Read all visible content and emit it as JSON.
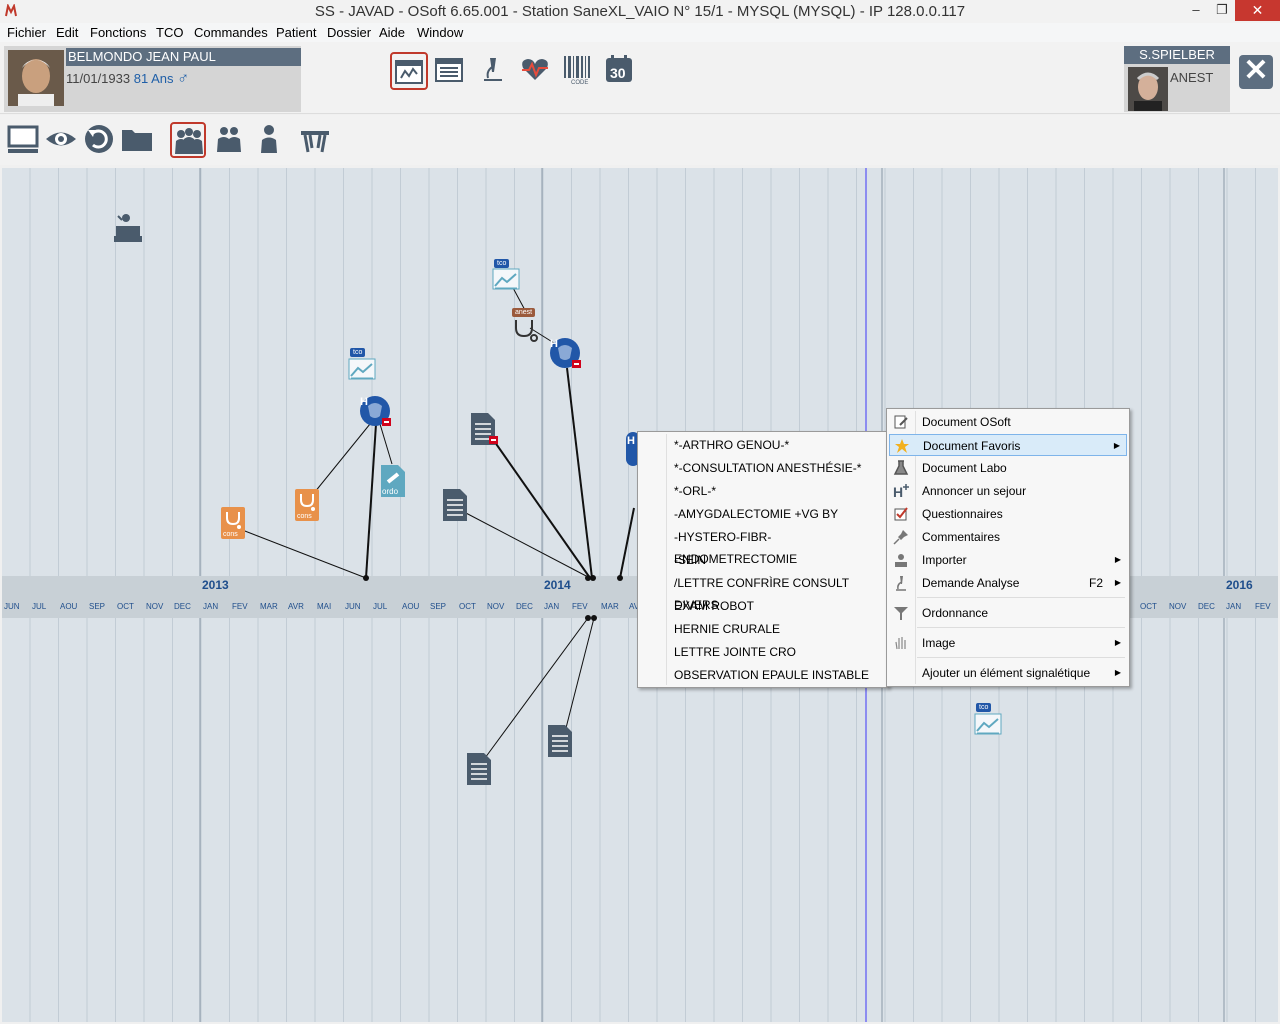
{
  "window": {
    "title": "SS - JAVAD - OSoft 6.65.001 - Station SaneXL_VAIO N° 15/1 - MYSQL (MYSQL) - IP 128.0.0.117",
    "minimize": "–",
    "maximize": "❐",
    "close": "✕"
  },
  "menubar": [
    "Fichier",
    "Edit",
    "Fonctions",
    "TCO",
    "Commandes",
    "Patient",
    "Dossier",
    "Aide",
    "Window"
  ],
  "patient": {
    "name": "BELMONDO  JEAN PAUL",
    "dob": "11/01/1933",
    "age": "81 Ans",
    "gender_symbol": "♂"
  },
  "user": {
    "name": "S.SPIELBER",
    "role": "ANEST"
  },
  "header_tools": [
    "timeline-icon",
    "document-list-icon",
    "microscope-icon",
    "heart-icon",
    "barcode-icon",
    "calendar-30-icon"
  ],
  "calendar_day": "30",
  "barcode_text": "CODE",
  "toolbar2": [
    "computer-icon",
    "eye-icon",
    "refresh-icon",
    "folder-icon",
    "group-icon",
    "couple-icon",
    "person-icon",
    "table-icon"
  ],
  "timeline": {
    "years": [
      "2013",
      "2014",
      "2016"
    ],
    "months_left": [
      "JUN",
      "JUL",
      "AOU",
      "SEP",
      "OCT",
      "NOV",
      "DEC",
      "JAN",
      "FEV",
      "MAR",
      "AVR",
      "MAI",
      "JUN",
      "JUL",
      "AOU",
      "SEP",
      "OCT",
      "NOV",
      "DEC",
      "JAN",
      "FEV",
      "MAR",
      "AV"
    ],
    "months_right": [
      "OCT",
      "NOV",
      "DEC",
      "JAN",
      "FEV"
    ],
    "tags": {
      "tco": "tco",
      "anest": "anest",
      "cons": "cons",
      "ordo": "ordo",
      "hospital": "H"
    }
  },
  "context_menu": {
    "items": [
      {
        "label": "Document OSoft",
        "icon": "document-edit-icon"
      },
      {
        "label": "Document Favoris",
        "icon": "star-icon",
        "submenu": true,
        "highlighted": true
      },
      {
        "label": "Document Labo",
        "icon": "flask-icon"
      },
      {
        "label": "Annoncer un sejour",
        "icon": "hospital-plus-icon"
      },
      {
        "label": "Questionnaires",
        "icon": "checkbox-icon"
      },
      {
        "label": "Commentaires",
        "icon": "pin-icon"
      },
      {
        "label": "Importer",
        "icon": "import-icon",
        "submenu": true
      },
      {
        "label": "Demande Analyse",
        "icon": "microscope-icon",
        "shortcut": "F2",
        "submenu": true
      },
      {
        "label": "Ordonnance",
        "icon": "funnel-icon"
      },
      {
        "label": "Image",
        "icon": "hand-icon",
        "submenu": true
      },
      {
        "label": "Ajouter un élément signalétique",
        "icon": "",
        "submenu": true
      }
    ]
  },
  "favorites_submenu": [
    "*-ARTHRO GENOU-*",
    "*-CONSULTATION ANESTHÉSIE-*",
    "*-ORL-*",
    "-AMYGDALECTOMIE +VG BY",
    "-HYSTERO-FIBR-ENDOMETRECTOMIE",
    "-SEIN",
    "/LETTRE CONFRÌRE CONSULT DIVERS",
    "EXAM ROBOT",
    "HERNIE CRURALE",
    "LETTRE JOINTE CRO",
    "OBSERVATION EPAULE INSTABLE"
  ],
  "colors": {
    "header_bar": "#5d6e80",
    "timeline_bg": "#dbe2e8",
    "timeline_band": "#c8d0d6",
    "node_dark": "#4a5b6c",
    "node_orange": "#e8914a",
    "node_teal": "#5fa8c0",
    "hospital_blue": "#2157a8",
    "active_border": "#c0392b",
    "menu_highlight": "#d9ebf9"
  }
}
